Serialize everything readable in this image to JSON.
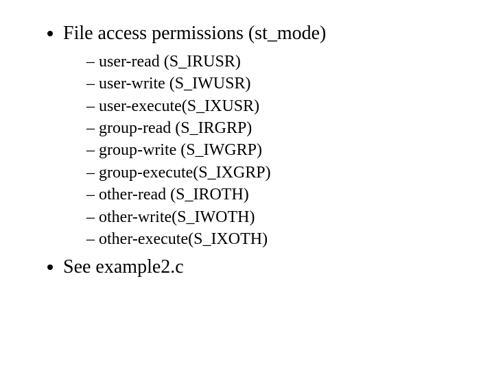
{
  "content": {
    "item1": "File access permissions (st_mode)",
    "sub": {
      "s0": "user-read (S_IRUSR)",
      "s1": "user-write (S_IWUSR)",
      "s2": "user-execute(S_IXUSR)",
      "s3": "group-read  (S_IRGRP)",
      "s4": "group-write (S_IWGRP)",
      "s5": "group-execute(S_IXGRP)",
      "s6": "other-read (S_IROTH)",
      "s7": "other-write(S_IWOTH)",
      "s8": "other-execute(S_IXOTH)"
    },
    "item2": "See example2.c"
  }
}
